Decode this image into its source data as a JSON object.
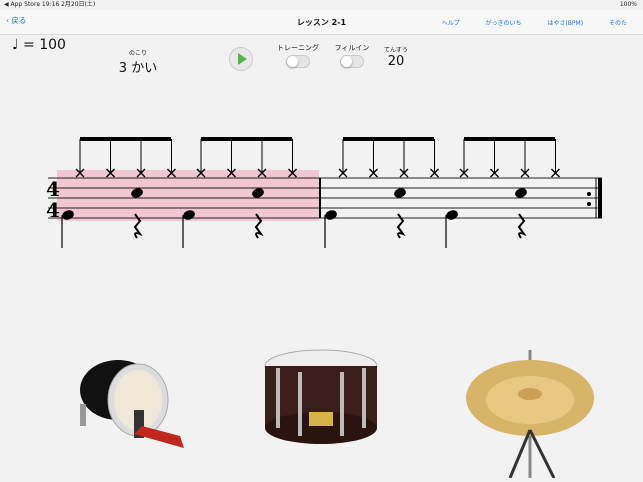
{
  "status_bar": {
    "left": "◀ App Store   19:16   2月20日(土)",
    "right": "100%"
  },
  "nav": {
    "back": "戻る",
    "title": "レッスン 2-1",
    "links": [
      "ヘルプ",
      "がっきのいち",
      "はやさ(BPM)",
      "そのた"
    ]
  },
  "tempo": "♩ = 100",
  "remaining": {
    "label": "のこり",
    "value": "3 かい"
  },
  "training": "トレーニング",
  "fillin": "フィルイン",
  "score": {
    "label": "てんすう",
    "value": "20"
  },
  "time_signature": [
    "4",
    "4"
  ],
  "colors": {
    "highlight": "#f2c6d2",
    "play": "#51b54b",
    "link": "#1a73e8"
  },
  "instruments": [
    "bass-drum",
    "snare-drum",
    "hi-hat"
  ]
}
